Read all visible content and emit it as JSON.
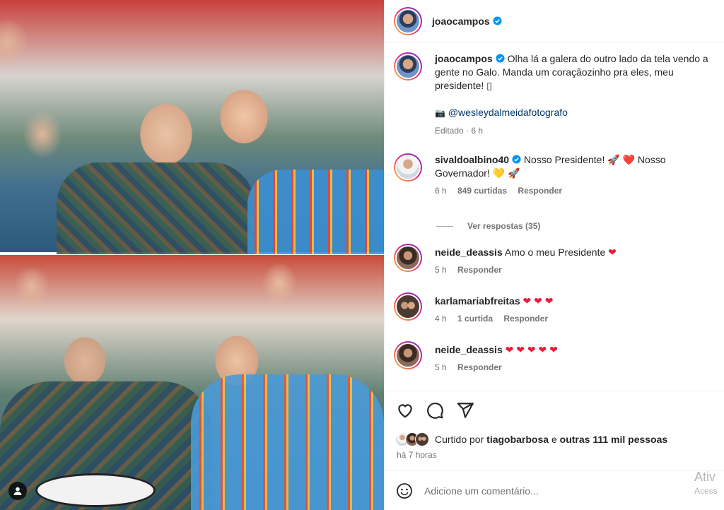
{
  "post": {
    "author": "joaocampos",
    "caption": "Olha lá a galera do outro lado da tela vendo a gente no Galo. Manda um coraçãozinho pra eles, meu presidente! ▯",
    "credit_emoji": "📷",
    "credit_mention": "@wesleydalmeidafotografo",
    "edited_label": "Editado",
    "edited_time": "6 h"
  },
  "comments": [
    {
      "username": "sivaldoalbino40",
      "verified": true,
      "text": "Nosso Presidente! 🚀 ❤️ Nosso Governador! 💛 🚀",
      "time": "6 h",
      "likes": "849 curtidas",
      "reply": "Responder",
      "view_replies": "Ver respostas (35)"
    },
    {
      "username": "neide_deassis",
      "text": "Amo o meu Presidente",
      "hearts": "❤",
      "time": "5 h",
      "reply": "Responder"
    },
    {
      "username": "karlamariabfreitas",
      "hearts": "❤ ❤ ❤",
      "time": "4 h",
      "likes": "1 curtida",
      "reply": "Responder"
    },
    {
      "username": "neide_deassis",
      "hearts": "❤ ❤ ❤ ❤ ❤",
      "time": "5 h",
      "reply": "Responder"
    }
  ],
  "actions": {
    "liked_by_prefix": "Curtido por",
    "liked_by_user": "tiagobarbosa",
    "liked_by_conjunction": "e",
    "liked_by_others": "outras 111 mil pessoas",
    "post_time": "há 7 horas"
  },
  "composer": {
    "placeholder": "Adicione um comentário..."
  },
  "watermark": {
    "line1": "Ativ",
    "line2": "Acess"
  },
  "colors": {
    "verified": "#0095f6",
    "heart": "#ed1a3a",
    "link": "#00376b"
  }
}
